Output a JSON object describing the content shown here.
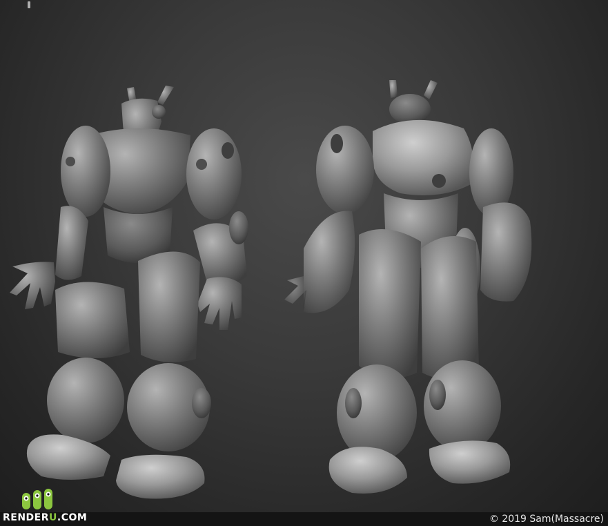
{
  "watermark": {
    "brand_main": "RENDER",
    "brand_accent": "U",
    "brand_suffix": ".COM",
    "accent_color": "#8cc63f"
  },
  "credit": {
    "copyright": "© 2019 Sam(Massacre)"
  },
  "scene": {
    "subject": "robot-sculpt-front-and-back-views",
    "material_color": "#7d7d7d",
    "background_color": "#2e2e2e"
  }
}
